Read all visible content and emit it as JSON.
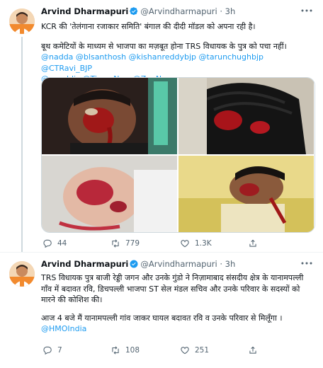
{
  "tweets": [
    {
      "author": {
        "name": "Arvind Dharmapuri",
        "handle": "@Arvindharmapuri",
        "dot": "·",
        "time": "3h"
      },
      "line1": "KCR की 'तेलंगाना रजाकार समिति' बंगाल की दीदी मॉडल को अपना रही है।",
      "line2": "बूथ कमेटियों के माध्यम से भाजपा का मज़बूत होना TRS विधायक के पुत्र को पचा नहीं।",
      "mentions": [
        "@nadda",
        "@blsanthosh",
        "@kishanreddybjp",
        "@tarunchughbjp",
        "@CTRavi_BJP",
        "@republic",
        "@TimesNow",
        "@ZeeNews"
      ],
      "stats": {
        "replies": "44",
        "retweets": "779",
        "likes": "1.3K"
      }
    },
    {
      "author": {
        "name": "Arvind Dharmapuri",
        "handle": "@Arvindharmapuri",
        "dot": "·",
        "time": "3h"
      },
      "para1": "TRS विधायक पुत्र बाजी रेड्डी जगन और उनके गुंडो ने निज़ामाबाद संसदीय क्षेत्र के यानामपल्ली गाँव में बदावत रवि, डिचपल्ली भाजपा ST सेल मंडल सचिव और उनके परिवार के सदस्यों को मारने की कोशिश की।",
      "para2": "आज 4 बजे मैं यानामपल्ली गांव जाकर घायल बदावत रवि व उनके परिवार से मिलूँगा ।",
      "mention": "@HMOIndia",
      "stats": {
        "replies": "7",
        "retweets": "108",
        "likes": "251"
      }
    }
  ],
  "colors": {
    "link": "#1d9bf0",
    "verified": "#1d9bf0",
    "muted": "#536471"
  },
  "icons": [
    "more-icon",
    "verified-badge-icon",
    "reply-icon",
    "retweet-icon",
    "like-icon",
    "share-icon"
  ]
}
